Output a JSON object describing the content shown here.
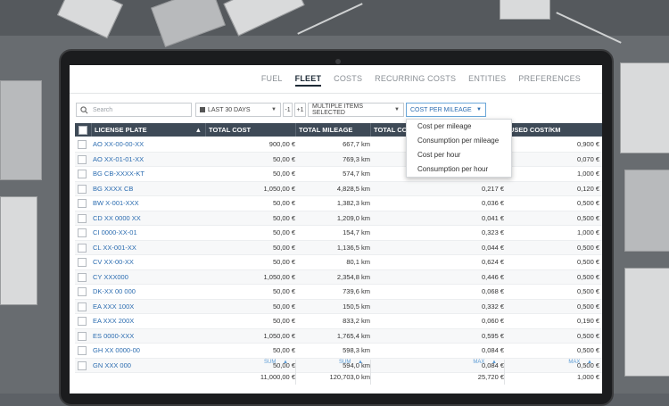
{
  "nav": {
    "tabs": [
      "FUEL",
      "FLEET",
      "COSTS",
      "RECURRING COSTS",
      "ENTITIES",
      "PREFERENCES"
    ],
    "active": "FLEET"
  },
  "toolbar": {
    "search_placeholder": "Search",
    "date_range": "LAST 30 DAYS",
    "minus_one": "-1",
    "plus_one": "+1",
    "multi_select": "MULTIPLE ITEMS SELECTED",
    "metric_select": "COST PER MILEAGE"
  },
  "dropdown": {
    "options": [
      "Cost per mileage",
      "Consumption per mileage",
      "Cost per hour",
      "Consumption per hour"
    ]
  },
  "table": {
    "headers": {
      "plate": "LICENSE PLATE",
      "total_cost": "TOTAL COST",
      "total_mileage": "TOTAL MILEAGE",
      "total_cost_per": "TOTAL COS",
      "used_cost": "USED COST/KM"
    },
    "rows": [
      {
        "plate": "AO XX-00-00-XX",
        "cost": "900,00 €",
        "mileage": "667,7 km",
        "cpk": "",
        "ucpk": "0,900 €"
      },
      {
        "plate": "AO XX-01-01-XX",
        "cost": "50,00 €",
        "mileage": "769,3 km",
        "cpk": "",
        "ucpk": "0,070 €"
      },
      {
        "plate": "BG CB-XXXX-KT",
        "cost": "50,00 €",
        "mileage": "574,7 km",
        "cpk": "",
        "ucpk": "1,000 €"
      },
      {
        "plate": "BG XXXX CB",
        "cost": "1,050,00 €",
        "mileage": "4,828,5 km",
        "cpk": "0,217 €",
        "ucpk": "0,120 €"
      },
      {
        "plate": "BW X-001-XXX",
        "cost": "50,00 €",
        "mileage": "1,382,3 km",
        "cpk": "0,036 €",
        "ucpk": "0,500 €"
      },
      {
        "plate": "CD XX 0000 XX",
        "cost": "50,00 €",
        "mileage": "1,209,0 km",
        "cpk": "0,041 €",
        "ucpk": "0,500 €"
      },
      {
        "plate": "CI 0000-XX-01",
        "cost": "50,00 €",
        "mileage": "154,7 km",
        "cpk": "0,323 €",
        "ucpk": "1,000 €"
      },
      {
        "plate": "CL XX-001-XX",
        "cost": "50,00 €",
        "mileage": "1,136,5 km",
        "cpk": "0,044 €",
        "ucpk": "0,500 €"
      },
      {
        "plate": "CV XX-00-XX",
        "cost": "50,00 €",
        "mileage": "80,1 km",
        "cpk": "0,624 €",
        "ucpk": "0,500 €"
      },
      {
        "plate": "CY XXX000",
        "cost": "1,050,00 €",
        "mileage": "2,354,8 km",
        "cpk": "0,446 €",
        "ucpk": "0,500 €"
      },
      {
        "plate": "DK-XX 00 000",
        "cost": "50,00 €",
        "mileage": "739,6 km",
        "cpk": "0,068 €",
        "ucpk": "0,500 €"
      },
      {
        "plate": "EA XXX 100X",
        "cost": "50,00 €",
        "mileage": "150,5 km",
        "cpk": "0,332 €",
        "ucpk": "0,500 €"
      },
      {
        "plate": "EA XXX 200X",
        "cost": "50,00 €",
        "mileage": "833,2 km",
        "cpk": "0,060 €",
        "ucpk": "0,190 €"
      },
      {
        "plate": "ES 0000-XXX",
        "cost": "1,050,00 €",
        "mileage": "1,765,4 km",
        "cpk": "0,595 €",
        "ucpk": "0,500 €"
      },
      {
        "plate": "GH XX 0000-00",
        "cost": "50,00 €",
        "mileage": "598,3 km",
        "cpk": "0,084 €",
        "ucpk": "0,500 €"
      },
      {
        "plate": "GN XXX 000",
        "cost": "50,00 €",
        "mileage": "594,0 km",
        "cpk": "0,084 €",
        "ucpk": "0,500 €"
      }
    ]
  },
  "footer": {
    "cost_agg": "SUM",
    "cost_total": "11,000,00 €",
    "mileage_agg": "SUM",
    "mileage_total": "120,703,0 km",
    "cpk_agg": "MAX",
    "cpk_total": "25,720 €",
    "ucpk_agg": "MAX",
    "ucpk_total": "1,000 €"
  },
  "colors": {
    "header_bg": "#3e4a57",
    "link": "#2b6cb0",
    "accent": "#5b9bd5"
  }
}
